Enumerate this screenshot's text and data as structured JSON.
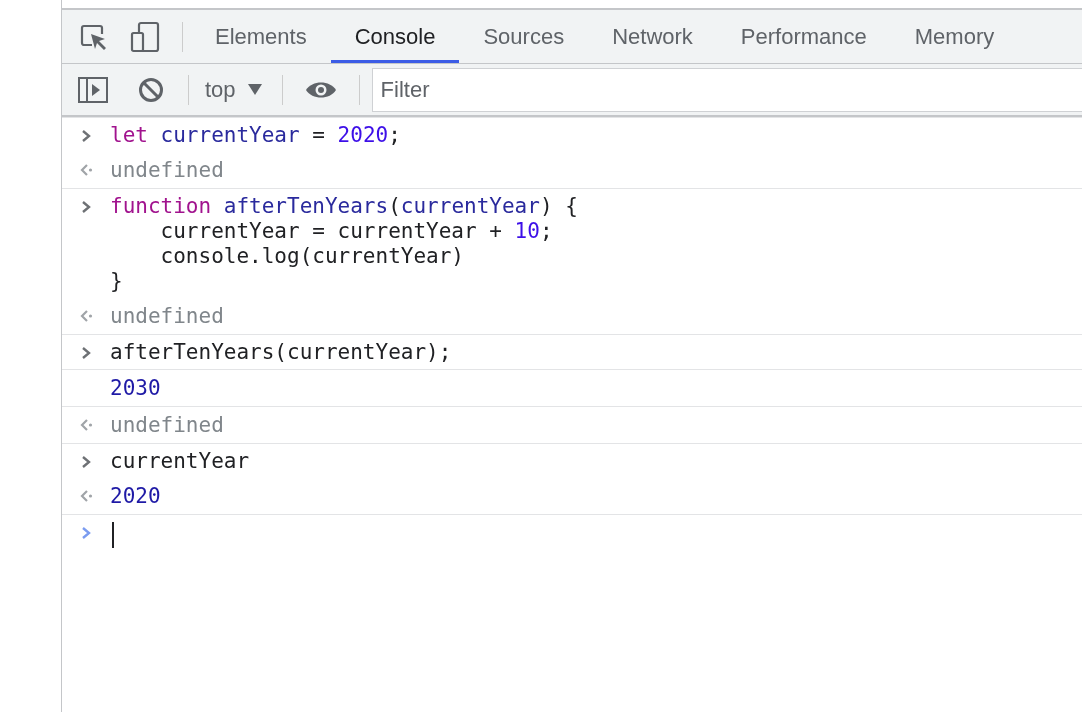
{
  "tabs": [
    {
      "label": "Elements",
      "selected": false
    },
    {
      "label": "Console",
      "selected": true
    },
    {
      "label": "Sources",
      "selected": false
    },
    {
      "label": "Network",
      "selected": false
    },
    {
      "label": "Performance",
      "selected": false
    },
    {
      "label": "Memory",
      "selected": false
    }
  ],
  "toolbar": {
    "context": "top",
    "filter": {
      "placeholder": "Filter"
    }
  },
  "entries": [
    {
      "kind": "input",
      "lines": [
        [
          {
            "text": "let",
            "color": "#a1138e"
          },
          {
            "text": " currentYear",
            "color": "#2a2a9d"
          },
          {
            "text": " = ",
            "color": "#202124"
          },
          {
            "text": "2020",
            "color": "#3d0fe8"
          },
          {
            "text": ";",
            "color": "#202124"
          }
        ]
      ]
    },
    {
      "kind": "result",
      "text": "undefined",
      "color": "#80868b"
    },
    {
      "kind": "input",
      "lines": [
        [
          {
            "text": "function",
            "color": "#a1138e"
          },
          {
            "text": " afterTenYears",
            "color": "#2a2a9d"
          },
          {
            "text": "(",
            "color": "#202124"
          },
          {
            "text": "currentYear",
            "color": "#2a2a9d"
          },
          {
            "text": ") {",
            "color": "#202124"
          }
        ],
        [
          {
            "text": "    currentYear = currentYear + ",
            "color": "#202124"
          },
          {
            "text": "10",
            "color": "#3d0fe8"
          },
          {
            "text": ";",
            "color": "#202124"
          }
        ],
        [
          {
            "text": "    console.log(currentYear)",
            "color": "#202124"
          }
        ],
        [
          {
            "text": "}",
            "color": "#202124"
          }
        ]
      ]
    },
    {
      "kind": "result",
      "text": "undefined",
      "color": "#80868b"
    },
    {
      "kind": "input",
      "lines": [
        [
          {
            "text": "afterTenYears(currentYear);",
            "color": "#202124"
          }
        ]
      ]
    },
    {
      "kind": "log",
      "text": "2030",
      "color": "#1f1aa6"
    },
    {
      "kind": "result",
      "text": "undefined",
      "color": "#80868b"
    },
    {
      "kind": "input",
      "lines": [
        [
          {
            "text": "currentYear",
            "color": "#202124"
          }
        ]
      ]
    },
    {
      "kind": "result",
      "text": "2020",
      "color": "#1f1aa6"
    }
  ],
  "prompt": {
    "focused": true
  }
}
